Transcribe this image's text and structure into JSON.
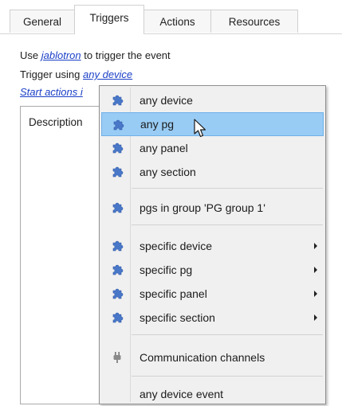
{
  "tabs": [
    {
      "label": "General"
    },
    {
      "label": "Triggers"
    },
    {
      "label": "Actions"
    },
    {
      "label": "Resources"
    }
  ],
  "trigger_line": {
    "prefix": "Use",
    "link": "jablotron",
    "suffix": "to trigger the event"
  },
  "using_line": {
    "prefix": "Trigger using",
    "link": "any device"
  },
  "start_actions_link": "Start actions i",
  "description_label": "Description",
  "menu": {
    "items": [
      {
        "label": "any device",
        "icon": "puzzle-icon"
      },
      {
        "label": "any pg",
        "icon": "puzzle-icon",
        "highlighted": true
      },
      {
        "label": "any panel",
        "icon": "puzzle-icon"
      },
      {
        "label": "any section",
        "icon": "puzzle-icon"
      },
      {
        "label": "pgs in group 'PG group 1'",
        "icon": "puzzle-icon"
      },
      {
        "label": "specific device",
        "icon": "puzzle-icon",
        "submenu": true
      },
      {
        "label": "specific pg",
        "icon": "puzzle-icon",
        "submenu": true
      },
      {
        "label": "specific panel",
        "icon": "puzzle-icon",
        "submenu": true
      },
      {
        "label": "specific section",
        "icon": "puzzle-icon",
        "submenu": true
      },
      {
        "label": "Communication channels",
        "icon": "plug-icon"
      },
      {
        "label": "any device event"
      }
    ],
    "highlight_color": "#99ccf5"
  },
  "colors": {
    "link": "#1a3fc7",
    "puzzle_icon": "#4a78c8"
  }
}
